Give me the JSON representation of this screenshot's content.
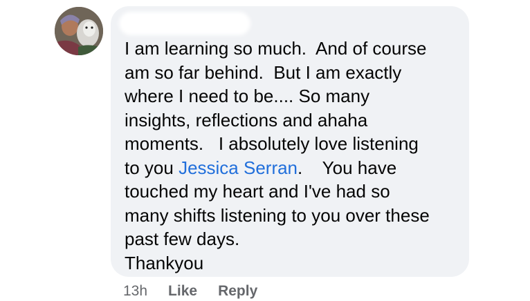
{
  "comment": {
    "author_name": "",
    "lines": [
      {
        "before": "I am learning so much.  And of course",
        "mention": "",
        "after": ""
      },
      {
        "before": "am so far behind.  But I am exactly",
        "mention": "",
        "after": ""
      },
      {
        "before": "where I need to be.... So many",
        "mention": "",
        "after": ""
      },
      {
        "before": "insights, reflections and ahaha",
        "mention": "",
        "after": ""
      },
      {
        "before": "moments.   I absolutely love listening",
        "mention": "",
        "after": ""
      },
      {
        "before": "to you ",
        "mention": "Jessica Serran",
        "after": ".    You have"
      },
      {
        "before": "touched my heart and I've had so",
        "mention": "",
        "after": ""
      },
      {
        "before": "many shifts listening to you over these",
        "mention": "",
        "after": ""
      },
      {
        "before": "past few days.",
        "mention": "",
        "after": ""
      },
      {
        "before": "Thankyou",
        "mention": "",
        "after": ""
      }
    ]
  },
  "meta": {
    "timestamp": "13h",
    "like_label": "Like",
    "reply_label": "Reply"
  },
  "colors": {
    "bubble": "#f0f2f5",
    "text": "#050505",
    "mention": "#216fdb",
    "meta": "#65676b"
  }
}
